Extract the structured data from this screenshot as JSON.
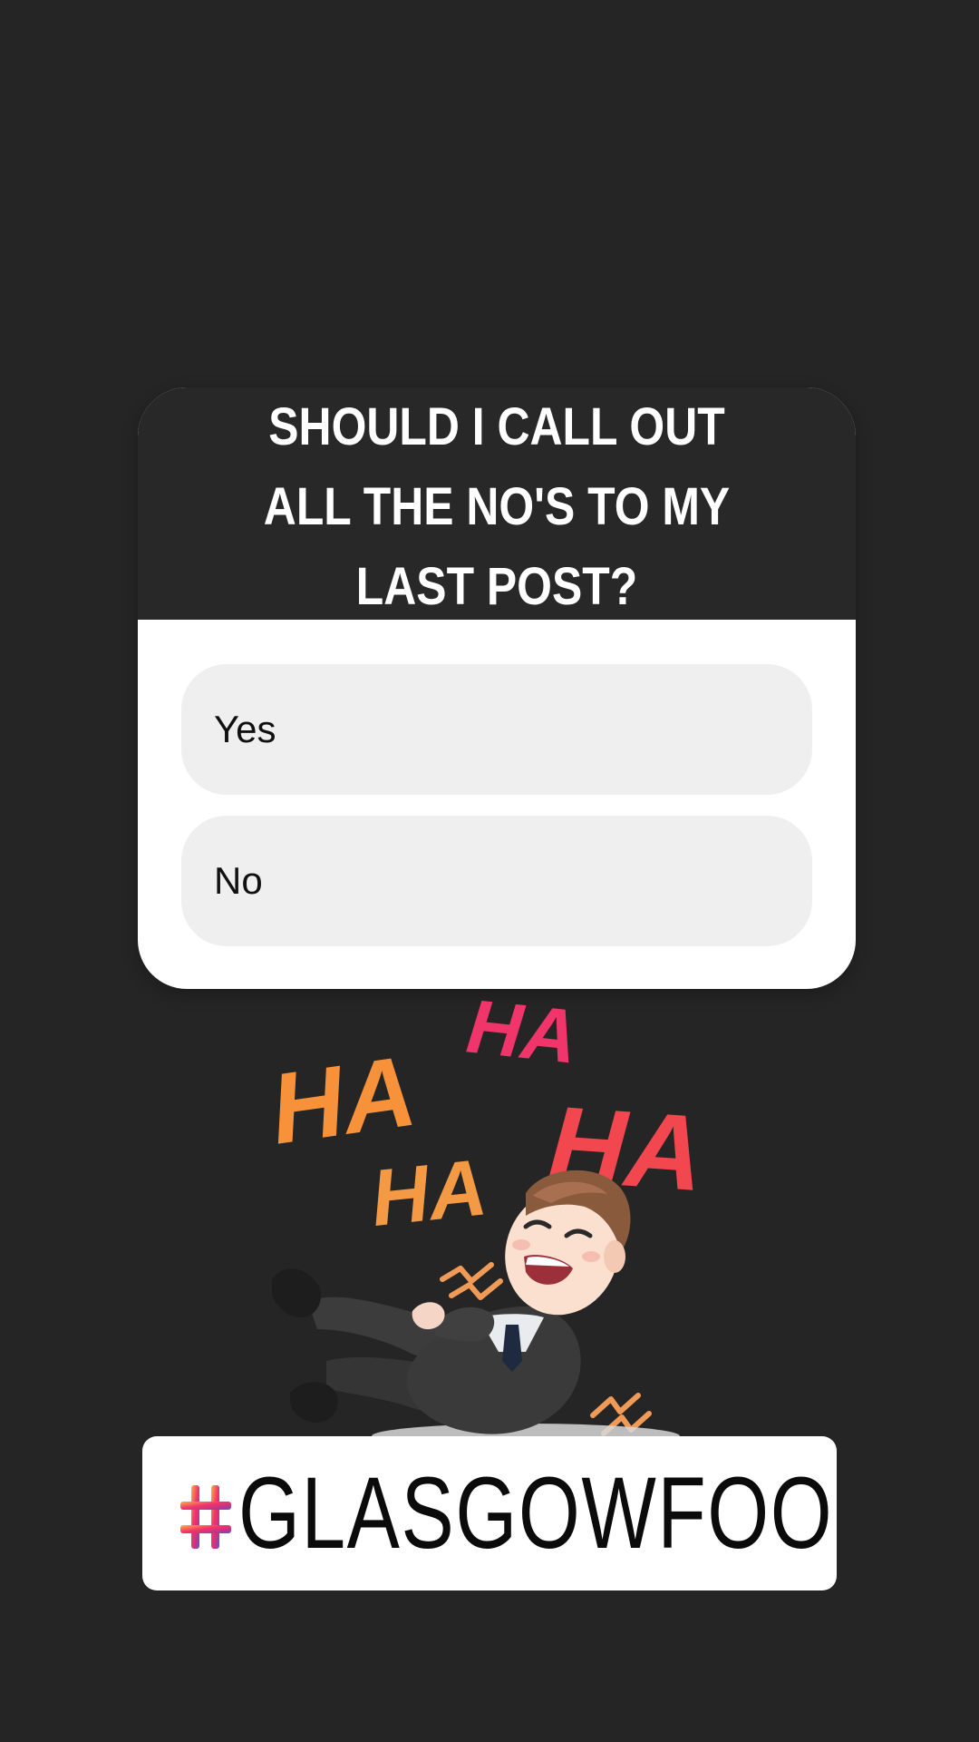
{
  "poll": {
    "question": "SHOULD I CALL OUT ALL THE NO'S TO MY LAST POST?",
    "options": [
      {
        "label": "Yes"
      },
      {
        "label": "No"
      }
    ]
  },
  "sticker": {
    "words": [
      "HA",
      "HA",
      "HA",
      "HA"
    ]
  },
  "hashtag": {
    "text": "GLASGOWFOOD",
    "icon": "hashtag-icon"
  },
  "colors": {
    "background": "#252525",
    "poll_header": "#282828",
    "option_bg": "#efefef",
    "ha_orange": "#f7923a",
    "ha_pink": "#f0356a",
    "ha_red": "#f2474f"
  }
}
